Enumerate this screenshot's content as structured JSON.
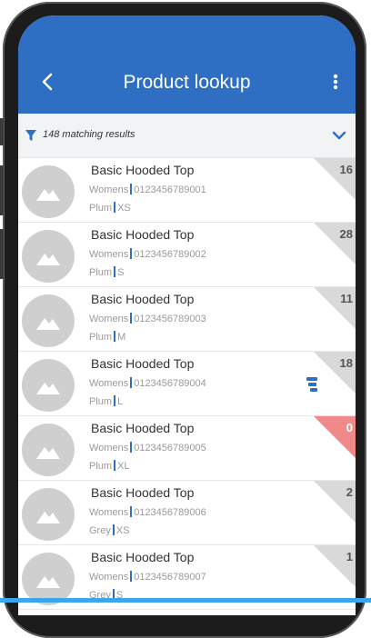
{
  "header": {
    "title": "Product lookup",
    "back_icon": "chevron-left-icon",
    "menu_icon": "more-vertical-icon",
    "bg_color": "#2e6fc4"
  },
  "filter": {
    "icon": "filter-icon",
    "count_text": "148 matching results",
    "expand_icon": "chevron-down-icon"
  },
  "products": [
    {
      "name": "Basic Hooded Top",
      "category": "Womens",
      "sku": "0123456789001",
      "color": "Plum",
      "size": "XS",
      "stock": "16",
      "negative": false,
      "drill": false
    },
    {
      "name": "Basic Hooded Top",
      "category": "Womens",
      "sku": "0123456789002",
      "color": "Plum",
      "size": "S",
      "stock": "28",
      "negative": false,
      "drill": false
    },
    {
      "name": "Basic Hooded Top",
      "category": "Womens",
      "sku": "0123456789003",
      "color": "Plum",
      "size": "M",
      "stock": "11",
      "negative": false,
      "drill": false
    },
    {
      "name": "Basic Hooded Top",
      "category": "Womens",
      "sku": "0123456789004",
      "color": "Plum",
      "size": "L",
      "stock": "18",
      "negative": false,
      "drill": true
    },
    {
      "name": "Basic Hooded Top",
      "category": "Womens",
      "sku": "0123456789005",
      "color": "Plum",
      "size": "XL",
      "stock": "0",
      "negative": true,
      "drill": false
    },
    {
      "name": "Basic Hooded Top",
      "category": "Womens",
      "sku": "0123456789006",
      "color": "Grey",
      "size": "XS",
      "stock": "2",
      "negative": false,
      "drill": false
    },
    {
      "name": "Basic Hooded Top",
      "category": "Womens",
      "sku": "0123456789007",
      "color": "Grey",
      "size": "S",
      "stock": "1",
      "negative": false,
      "drill": false
    }
  ]
}
